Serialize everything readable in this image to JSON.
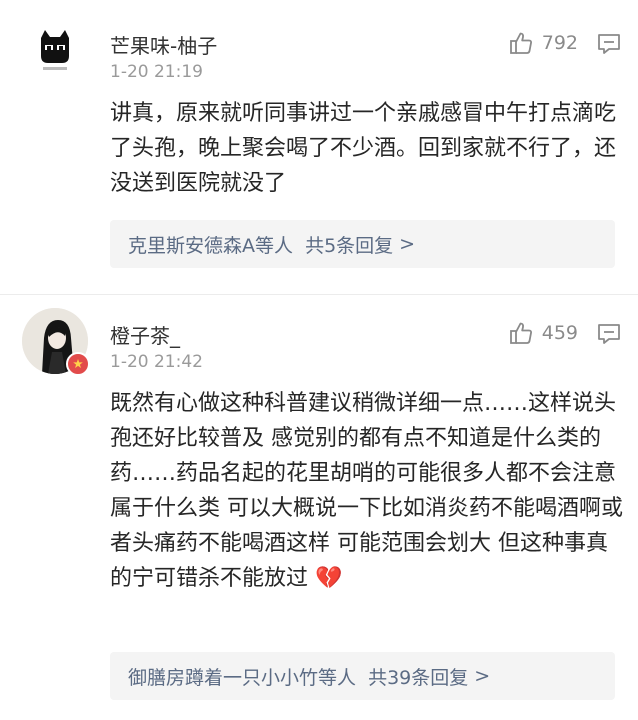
{
  "comments": [
    {
      "username": "芒果味-柚子",
      "time": "1-20 21:19",
      "likes": "792",
      "text": "讲真，原来就听同事讲过一个亲戚感冒中午打点滴吃了头孢，晚上聚会喝了不少酒。回到家就不行了，还没送到医院就没了",
      "replies": "克里斯安德森A等人  共5条回复",
      "chevron": ">",
      "avatar_icon": "black-cat-avatar-icon"
    },
    {
      "username": "橙子茶_",
      "time": "1-20 21:42",
      "likes": "459",
      "text": "既然有心做这种科普建议稍微详细一点……这样说头孢还好比较普及 感觉别的都有点不知道是什么类的药……药品名起的花里胡哨的可能很多人都不会注意属于什么类 可以大概说一下比如消炎药不能喝酒啊或者头痛药不能喝酒这样 可能范围会划大 但这种事真的宁可错杀不能放过",
      "emoji": "💔",
      "replies": "御膳房蹲着一只小小竹等人  共39条回复",
      "chevron": ">",
      "avatar_icon": "anime-girl-avatar-icon"
    }
  ],
  "colors": {
    "reply_link": "#5b6b84",
    "meta": "#9a9a9a",
    "badge": "#e24b4b"
  }
}
